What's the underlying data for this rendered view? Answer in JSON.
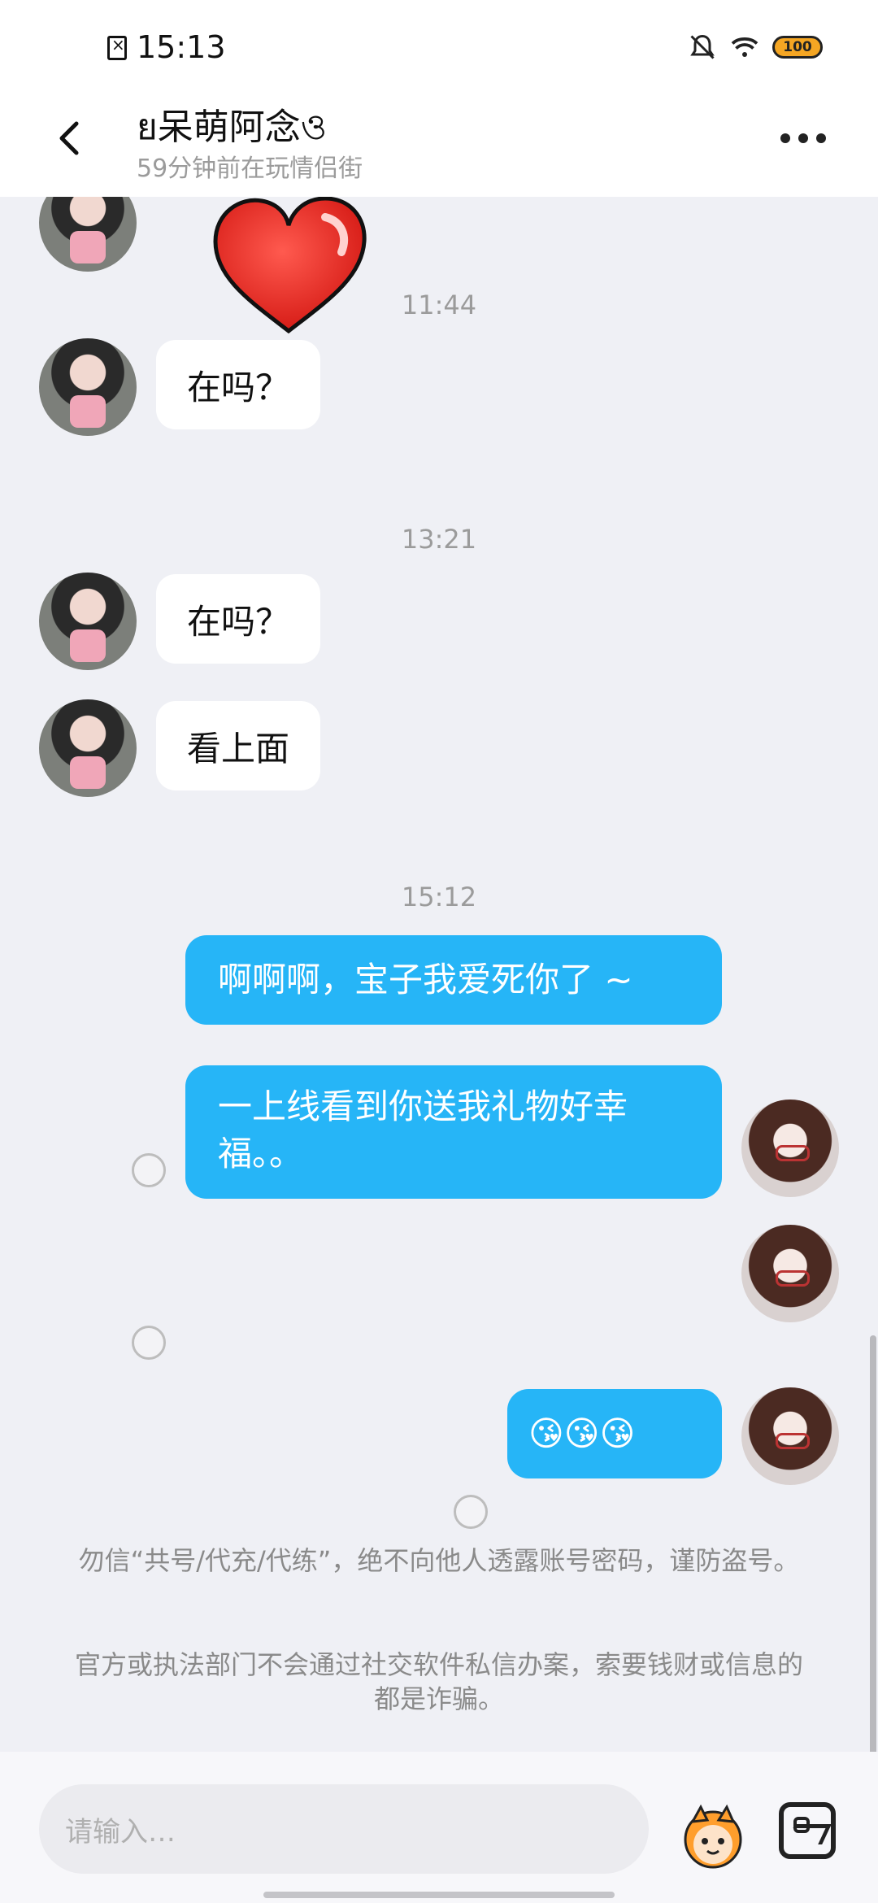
{
  "status": {
    "time": "15:13",
    "battery": "100"
  },
  "header": {
    "title": "ย呆萌阿念ও",
    "subtitle": "59分钟前在玩情侣街"
  },
  "messages": {
    "t1": "11:44",
    "m1": "在吗？",
    "t2": "13:21",
    "m2": "在吗？",
    "m3": "看上面",
    "t3": "15:12",
    "r1": "啊啊啊，宝子我爱死你了 ~",
    "r2": "一上线看到你送我礼物好幸福。。",
    "r3": "😘😘😘"
  },
  "notices": {
    "n1": "勿信“共号/代充/代练”，绝不向他人透露账号密码，谨防盗号。",
    "n2": "官方或执法部门不会通过社交软件私信办案，索要钱财或信息的都是诈骗。"
  },
  "input": {
    "placeholder": "请输入…"
  },
  "colors": {
    "accent": "#26b5f7",
    "background": "#eff0f5"
  }
}
